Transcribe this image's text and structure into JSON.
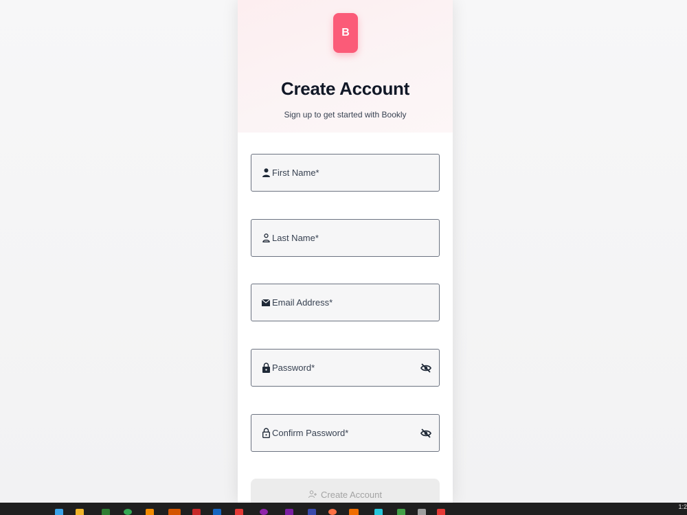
{
  "brand": {
    "logo_letter": "B",
    "color": "#fb5b78"
  },
  "header": {
    "title": "Create Account",
    "subtitle": "Sign up to get started with Bookly"
  },
  "form": {
    "fields": [
      {
        "label": "First Name*",
        "icon": "user-icon"
      },
      {
        "label": "Last Name*",
        "icon": "user-outline-icon"
      },
      {
        "label": "Email Address*",
        "icon": "mail-icon"
      },
      {
        "label": "Password*",
        "icon": "lock-icon",
        "toggle_icon": "eye-off-icon"
      },
      {
        "label": "Confirm Password*",
        "icon": "lock-outline-icon",
        "toggle_icon": "eye-off-icon"
      }
    ],
    "submit_label": "Create Account",
    "submit_icon": "user-plus-icon"
  },
  "taskbar": {
    "time": "1:2"
  }
}
